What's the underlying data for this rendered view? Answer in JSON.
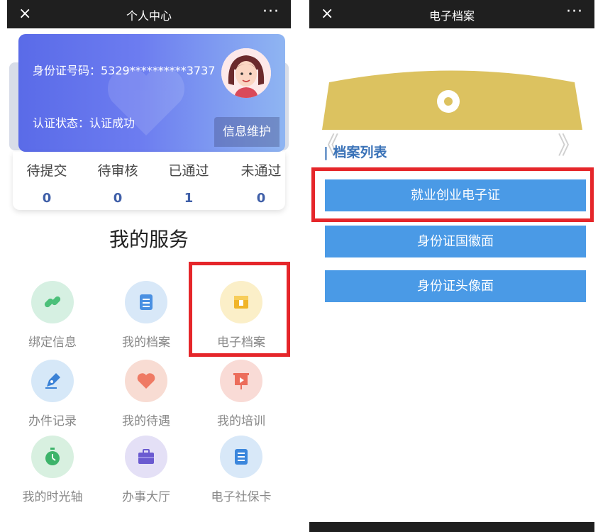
{
  "left": {
    "topbar": {
      "close": "×",
      "title": "个人中心",
      "more": "···"
    },
    "card": {
      "id_line": "身份证号码：5329**********3737",
      "status_line": "认证状态：认证成功",
      "maintain_button": "信息维护"
    },
    "stats": [
      {
        "label": "待提交",
        "value": "0"
      },
      {
        "label": "待审核",
        "value": "0"
      },
      {
        "label": "已通过",
        "value": "1"
      },
      {
        "label": "未通过",
        "value": "0"
      }
    ],
    "services_title": "我的服务",
    "services": [
      {
        "label": "绑定信息",
        "icon": "link-icon",
        "bg": "#d6f0e2",
        "color": "#4cc07a"
      },
      {
        "label": "我的档案",
        "icon": "document-icon",
        "bg": "#d8e8f8",
        "color": "#4a90e2"
      },
      {
        "label": "电子档案",
        "icon": "box-icon",
        "bg": "#fbefc8",
        "color": "#f0b429"
      },
      {
        "label": "办件记录",
        "icon": "pen-icon",
        "bg": "#d6e8f8",
        "color": "#3b82d6"
      },
      {
        "label": "我的待遇",
        "icon": "heart-icon",
        "bg": "#f8dcd3",
        "color": "#ef7a64"
      },
      {
        "label": "我的培训",
        "icon": "training-board-icon",
        "bg": "#f9dbd6",
        "color": "#ec6d5b"
      },
      {
        "label": "我的时光轴",
        "icon": "stopwatch-icon",
        "bg": "#d8f0e0",
        "color": "#3db36a"
      },
      {
        "label": "办事大厅",
        "icon": "briefcase-icon",
        "bg": "#e4e0f6",
        "color": "#6a5ad0"
      },
      {
        "label": "电子社保卡",
        "icon": "card-icon",
        "bg": "#d8e8f8",
        "color": "#3b86dc"
      }
    ],
    "colors": {
      "highlight": "#e5262a",
      "card_start": "#5a6be8",
      "card_end": "#8fb5f2"
    }
  },
  "right": {
    "topbar": {
      "close": "×",
      "title": "电子档案",
      "more": "···"
    },
    "archive_list_title": "| 档案列表",
    "arrow_left": "《",
    "arrow_right": "》",
    "items": [
      {
        "label": "就业创业电子证"
      },
      {
        "label": "身份证国徽面"
      },
      {
        "label": "身份证头像面"
      }
    ],
    "colors": {
      "button": "#4a9ae6",
      "banner": "#dcc260",
      "highlight": "#e5262a"
    }
  }
}
